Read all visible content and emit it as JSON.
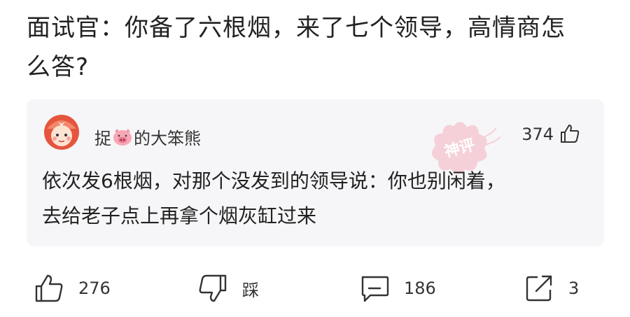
{
  "question": {
    "line1": "面试官：你备了六根烟，来了七个领导，高情商怎",
    "line2": "么答?"
  },
  "comment": {
    "user_prefix": "捉",
    "user_suffix": "的大笨熊",
    "likes": "374",
    "stamp": "神评",
    "line1": "依次发6根烟，对那个没发到的领导说：你也别闲着，",
    "line2": "去给老子点上再拿个烟灰缸过来"
  },
  "actions": {
    "like": "276",
    "dislike": "踩",
    "comments": "186",
    "share": "3"
  },
  "colors": {
    "card_bg": "#f6f6f8",
    "stamp": "#f6c9d3",
    "avatar_accent": "#e5553e"
  }
}
